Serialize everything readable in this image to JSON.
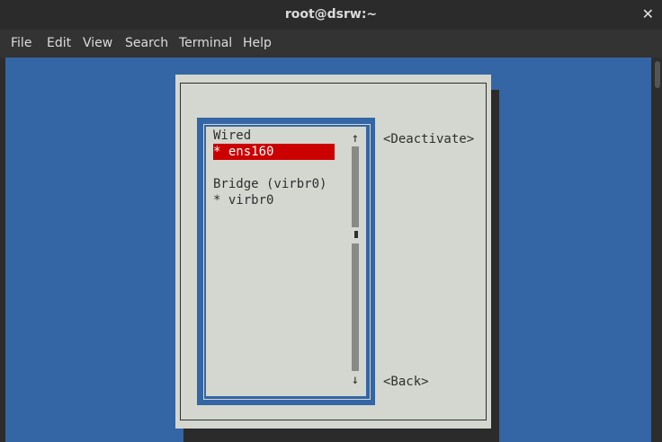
{
  "window": {
    "title": "root@dsrw:~",
    "close_glyph": "✕"
  },
  "menubar": {
    "items": [
      "File",
      "Edit",
      "View",
      "Search",
      "Terminal",
      "Help"
    ]
  },
  "nmtui": {
    "connections": [
      {
        "text": "Wired",
        "selected": false
      },
      {
        "text": "* ens160",
        "selected": true
      },
      {
        "text": "",
        "selected": false
      },
      {
        "text": "Bridge (virbr0)",
        "selected": false
      },
      {
        "text": "* virbr0",
        "selected": false
      }
    ],
    "scroll_up": "↑",
    "scroll_down": "↓",
    "deactivate_button": "<Deactivate>",
    "back_button": "<Back>"
  },
  "colors": {
    "terminal_bg": "#3465a4",
    "dialog_bg": "#d3d7cf",
    "selection_bg": "#cc0000",
    "chrome_bg": "#2b2b2b"
  }
}
